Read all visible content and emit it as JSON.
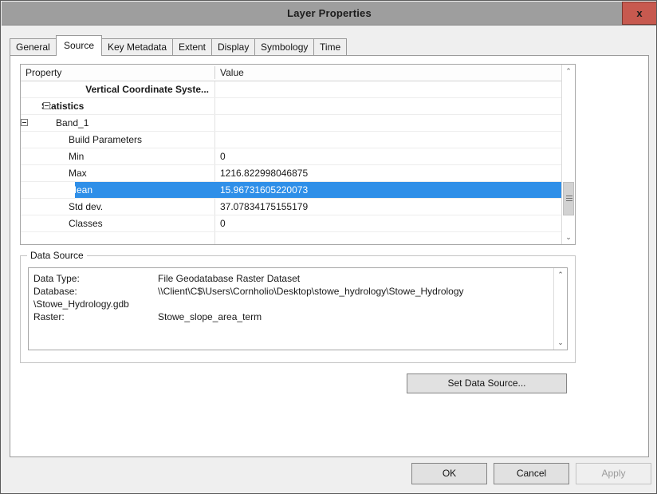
{
  "window": {
    "title": "Layer Properties",
    "close_label": "x"
  },
  "tabs": [
    {
      "label": "General",
      "active": false
    },
    {
      "label": "Source",
      "active": true
    },
    {
      "label": "Key Metadata",
      "active": false
    },
    {
      "label": "Extent",
      "active": false
    },
    {
      "label": "Display",
      "active": false
    },
    {
      "label": "Symbology",
      "active": false
    },
    {
      "label": "Time",
      "active": false
    }
  ],
  "property_grid": {
    "headers": {
      "property": "Property",
      "value": "Value"
    },
    "rows": [
      {
        "property": "Vertical Coordinate Syste...",
        "value": ""
      },
      {
        "property": "Statistics",
        "value": ""
      },
      {
        "property": "Band_1",
        "value": ""
      },
      {
        "property": "Build Parameters",
        "value": ""
      },
      {
        "property": "Min",
        "value": "0"
      },
      {
        "property": "Max",
        "value": "1216.822998046875"
      },
      {
        "property": "Mean",
        "value": "15.96731605220073"
      },
      {
        "property": "Std dev.",
        "value": "37.07834175155179"
      },
      {
        "property": "Classes",
        "value": "0"
      }
    ],
    "selected_row_index": 6,
    "selection_color": "#2f8fe8"
  },
  "data_source": {
    "legend": "Data Source",
    "lines": [
      {
        "label": "Data Type:",
        "value": "File Geodatabase Raster Dataset"
      },
      {
        "label": "Database:",
        "value": "\\\\Client\\C$\\Users\\Cornholio\\Desktop\\stowe_hydrology\\Stowe_Hydrology"
      }
    ],
    "database_continuation": "\\Stowe_Hydrology.gdb",
    "raster": {
      "label": "Raster:",
      "value": "Stowe_slope_area_term"
    },
    "set_button_label": "Set Data Source..."
  },
  "footer": {
    "ok": "OK",
    "cancel": "Cancel",
    "apply": "Apply"
  },
  "icons": {
    "scroll_up": "⌃",
    "scroll_down": "⌄"
  }
}
